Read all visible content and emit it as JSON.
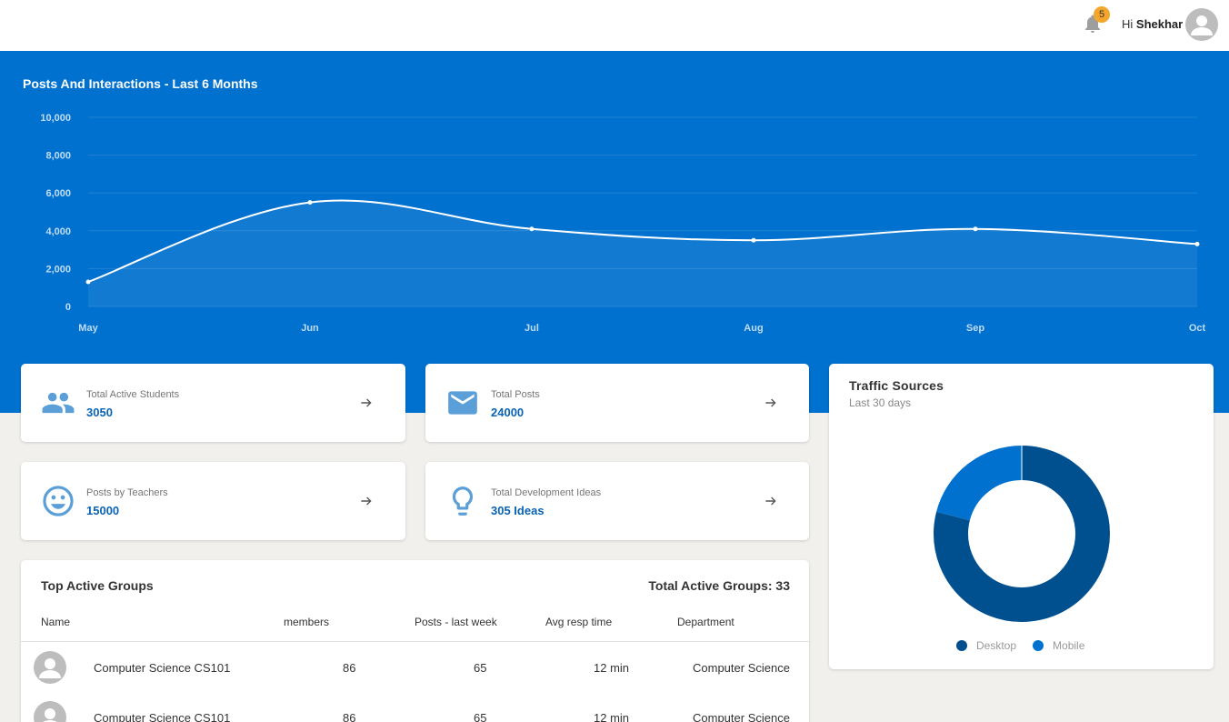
{
  "header": {
    "notification_count": "5",
    "greeting_prefix": "Hi",
    "user_name": "Shekhar"
  },
  "posts_chart": {
    "title": "Posts And Interactions - Last 6 Months"
  },
  "chart_data": {
    "type": "line",
    "title": "Posts And Interactions - Last 6 Months",
    "categories": [
      "May",
      "Jun",
      "Jul",
      "Aug",
      "Sep",
      "Oct"
    ],
    "values": [
      1300,
      5500,
      4100,
      3500,
      4100,
      3300
    ],
    "ylim": [
      0,
      10000
    ],
    "yticks": [
      "0",
      "2,000",
      "4,000",
      "6,000",
      "8,000",
      "10,000"
    ],
    "grid": true,
    "xlabel": "",
    "ylabel": ""
  },
  "stats": [
    {
      "label": "Total Active Students",
      "value": "3050",
      "icon": "people-icon"
    },
    {
      "label": "Total Posts",
      "value": "24000",
      "icon": "mail-icon"
    },
    {
      "label": "Posts by Teachers",
      "value": "15000",
      "icon": "smiley-icon"
    },
    {
      "label": "Total Development Ideas",
      "value": "305 Ideas",
      "icon": "lightbulb-icon"
    }
  ],
  "traffic": {
    "title": "Traffic Sources",
    "subtitle": "Last 30 days",
    "legend": [
      {
        "name": "Desktop",
        "color": "#00508f"
      },
      {
        "name": "Mobile",
        "color": "#0071ce"
      }
    ],
    "desktop_fraction": 0.79,
    "mobile_fraction": 0.21
  },
  "groups": {
    "title": "Top Active Groups",
    "total_label": "Total Active Groups:",
    "total_value": "33",
    "columns": [
      "Name",
      "members",
      "Posts - last week",
      "Avg resp time",
      "Department"
    ],
    "rows": [
      {
        "name": "Computer Science CS101",
        "members": "86",
        "posts": "65",
        "resp": "12 min",
        "dept": "Computer Science"
      },
      {
        "name": "Computer Science CS101",
        "members": "86",
        "posts": "65",
        "resp": "12 min",
        "dept": "Computer Science"
      }
    ]
  },
  "colors": {
    "brand_blue": "#0071ce",
    "desktop": "#00508f",
    "mobile": "#0071ce",
    "stat_value": "#0a63b3",
    "badge": "#f4a62a"
  }
}
